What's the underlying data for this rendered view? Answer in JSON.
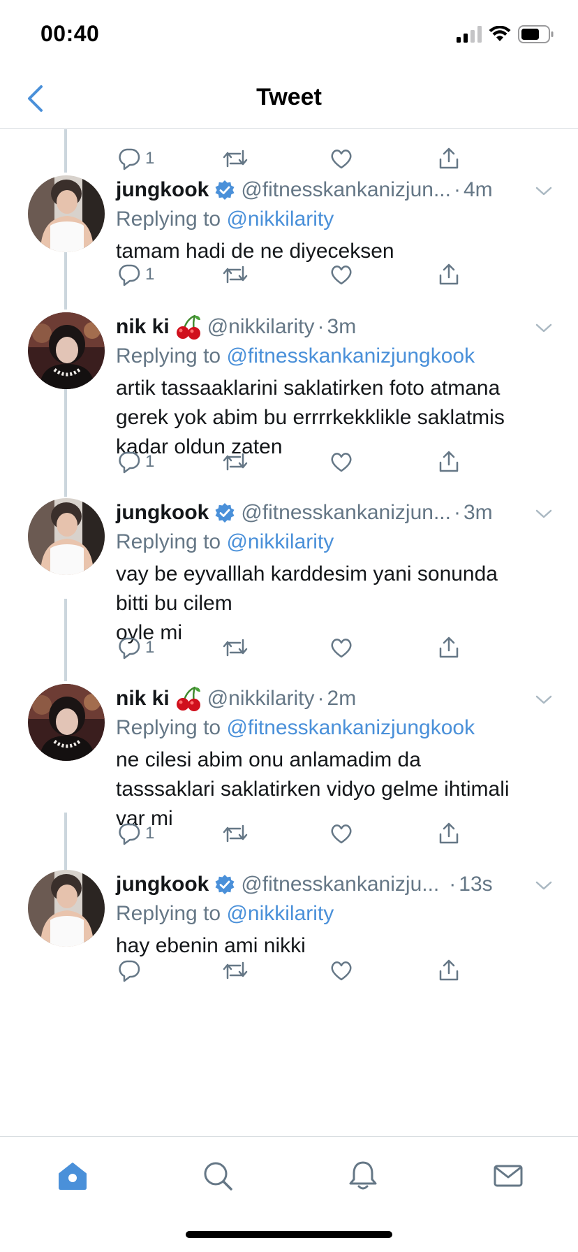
{
  "status_bar": {
    "time": "00:40"
  },
  "header": {
    "title": "Tweet"
  },
  "colors": {
    "accent": "#4a90d9",
    "muted": "#657786",
    "text": "#14171a",
    "divider": "#d6dbdf"
  },
  "tweets": [
    {
      "name": "jungkook",
      "verified": true,
      "handle": "@fitnesskankanizjun...",
      "time": "4m",
      "replying_label": "Replying to",
      "replying_to": "@nikkilarity",
      "text": "tamam hadi de ne diyeceksen",
      "reply_count": "1"
    },
    {
      "name": "nik ki",
      "emoji": "cherries-emoji",
      "handle": "@nikkilarity",
      "time": "3m",
      "replying_label": "Replying to",
      "replying_to": "@fitnesskankanizjungkook",
      "text": "artik tassaaklarini saklatirken foto atmana\ngerek yok abim bu errrrkekklikle saklatmis\nkadar oldun zaten",
      "reply_count": "1"
    },
    {
      "name": "jungkook",
      "verified": true,
      "handle": "@fitnesskankanizjun...",
      "time": "3m",
      "replying_label": "Replying to",
      "replying_to": "@nikkilarity",
      "text": "vay be eyvalllah karddesim yani sonunda\nbitti bu cilem\noyle mi",
      "reply_count": "1"
    },
    {
      "name": "nik ki",
      "emoji": "cherries-emoji",
      "handle": "@nikkilarity",
      "time": "2m",
      "replying_label": "Replying to",
      "replying_to": "@fitnesskankanizjungkook",
      "text": "ne cilesi abim onu anlamadim da\ntasssaklari saklatirken vidyo gelme ihtimali\nvar mi",
      "reply_count": "1"
    },
    {
      "name": "jungkook",
      "verified": true,
      "handle": "@fitnesskankanizju...",
      "time": "13s",
      "replying_label": "Replying to",
      "replying_to": "@nikkilarity",
      "text": "hay ebenin ami nikki",
      "reply_count": ""
    }
  ],
  "top_partial_actions": {
    "reply_count": "1"
  },
  "tab_bar": {
    "tabs": [
      "home-icon",
      "search-icon",
      "notifications-icon",
      "messages-icon"
    ],
    "active": "home-icon"
  }
}
